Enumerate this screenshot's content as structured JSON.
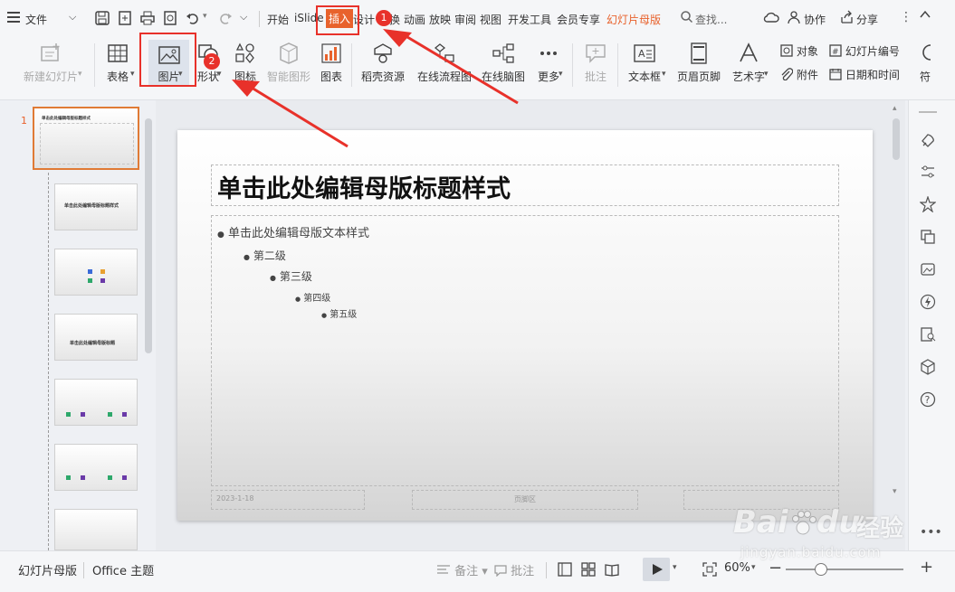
{
  "menubar": {
    "file_label": "文件",
    "tabs": [
      "开始",
      "iSlide",
      "插入",
      "设计",
      "切换",
      "动画",
      "放映",
      "审阅",
      "视图",
      "开发工具",
      "会员专享",
      "幻灯片母版"
    ],
    "search_label": "查找...",
    "collab_label": "协作",
    "share_label": "分享"
  },
  "ribbon": {
    "new_slide": "新建幻灯片",
    "table": "表格",
    "picture": "图片",
    "shape": "形状",
    "icon": "图标",
    "smart_graphic": "智能图形",
    "chart": "图表",
    "docer": "稻壳资源",
    "flowchart": "在线流程图",
    "mindmap": "在线脑图",
    "more": "更多",
    "comment": "批注",
    "textbox": "文本框",
    "header_footer": "页眉页脚",
    "wordart": "艺术字",
    "object": "对象",
    "attachment": "附件",
    "slide_number": "幻灯片编号",
    "datetime": "日期和时间",
    "symbol": "符"
  },
  "annotations": {
    "badge1": "1",
    "badge2": "2"
  },
  "thumbnails": {
    "first_number": "1",
    "first_title": "单击此处编辑母版标题样式",
    "second_title": "单击此处编辑母版标题样式",
    "fourth_title": "单击此处编辑母版标题"
  },
  "slide": {
    "title": "单击此处编辑母版标题样式",
    "levels": [
      "单击此处编辑母版文本样式",
      "第二级",
      "第三级",
      "第四级",
      "第五级"
    ],
    "date": "2023-1-18",
    "footer": "页脚区"
  },
  "statusbar": {
    "mode": "幻灯片母版",
    "theme": "Office 主题",
    "notes": "备注",
    "comments": "批注",
    "zoom": "60%"
  },
  "watermark": {
    "brand": "Bai",
    "brand2": "du",
    "jingyan": "经验",
    "url": "jingyan.baidu.com"
  },
  "colors": {
    "accent": "#e8312a",
    "active_tab_bg": "#e8622c",
    "master_tab": "#e8622c"
  }
}
